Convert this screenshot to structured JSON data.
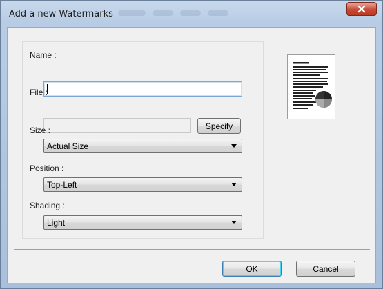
{
  "window": {
    "title": "Add a new Watermarks"
  },
  "form": {
    "name_label": "Name :",
    "name_value": "",
    "file_label": "File :",
    "file_value": "",
    "specify_label": "Specify",
    "size_label": "Size :",
    "size_value": "Actual Size",
    "position_label": "Position :",
    "position_value": "Top-Left",
    "shading_label": "Shading :",
    "shading_value": "Light"
  },
  "buttons": {
    "ok": "OK",
    "cancel": "Cancel"
  },
  "icons": {
    "close": "close-icon",
    "dropdown": "chevron-down-icon",
    "preview": "document-preview-icon"
  },
  "colors": {
    "close_button": "#c84a36",
    "window_frame": "#b8cde5",
    "dialog_body": "#f0f0f0"
  }
}
